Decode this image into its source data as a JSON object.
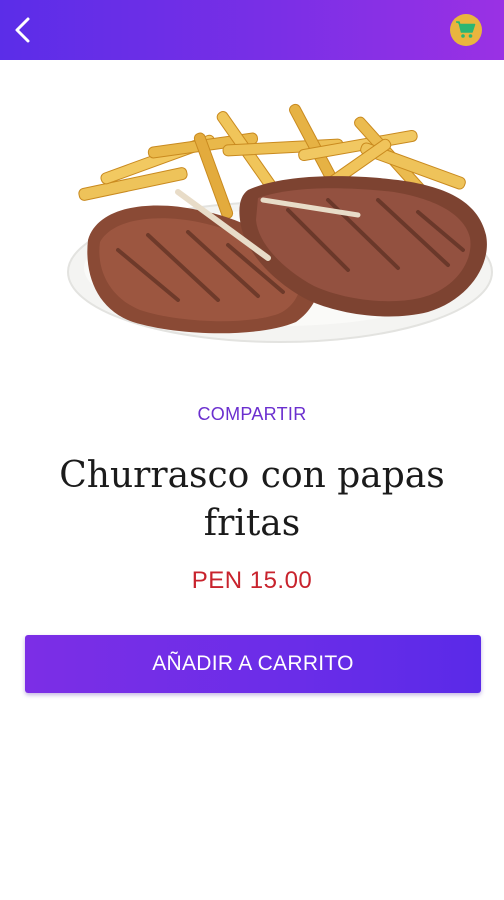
{
  "header": {
    "back_icon": "chevron-left-icon",
    "cart_icon": "shopping-cart-icon",
    "colors": {
      "gradient_start": "#5b2de8",
      "gradient_end": "#9a31e4",
      "cart_badge": "#e9b53e",
      "cart_glyph": "#2bb673"
    }
  },
  "product": {
    "image_alt": "Churrasco con papas fritas",
    "share_label": "COMPARTIR",
    "title": "Churrasco con papas fritas",
    "price": "PEN 15.00",
    "add_to_cart_label": "AÑADIR A CARRITO",
    "colors": {
      "share": "#6b2fcf",
      "price": "#c8232d",
      "button": "#6a2de8"
    }
  }
}
